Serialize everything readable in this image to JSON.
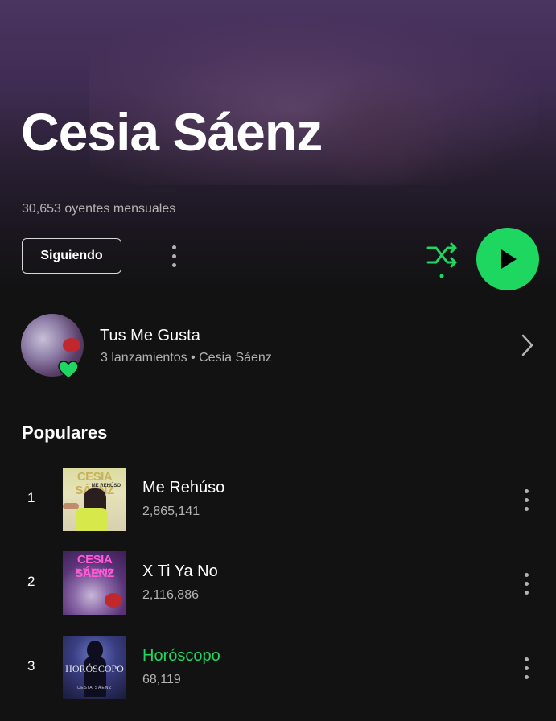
{
  "artist": {
    "name": "Cesia Sáenz",
    "monthly_listeners": "30,653 oyentes mensuales"
  },
  "actions": {
    "follow_label": "Siguiendo",
    "more_icon": "more-vertical-icon",
    "shuffle_icon": "shuffle-icon",
    "play_icon": "play-icon"
  },
  "release": {
    "title": "Tus Me Gusta",
    "subtitle": "3 lanzamientos • Cesia Sáenz",
    "badge_icon": "heart-icon",
    "chevron_icon": "chevron-right-icon"
  },
  "popular": {
    "heading": "Populares",
    "tracks": [
      {
        "number": "1",
        "title": "Me Rehúso",
        "plays": "2,865,141",
        "art_line1": "CESIA SÁENZ",
        "art_line2": "ME REHÚSO"
      },
      {
        "number": "2",
        "title": "X Ti Ya No",
        "plays": "2,116,886",
        "art_line1": "CESIA SÁENZ",
        "art_line2": "X TI YA NO"
      },
      {
        "number": "3",
        "title": "Horóscopo",
        "plays": "68,119",
        "art_line1": "HORÓSCOPO",
        "art_line2": "CESIA SÁENZ"
      }
    ]
  },
  "colors": {
    "accent_green": "#1ed760",
    "active_track_title": "#1ed760",
    "background": "#121212",
    "hero_purple": "#4a3461",
    "secondary_text": "#b3b3b3"
  }
}
